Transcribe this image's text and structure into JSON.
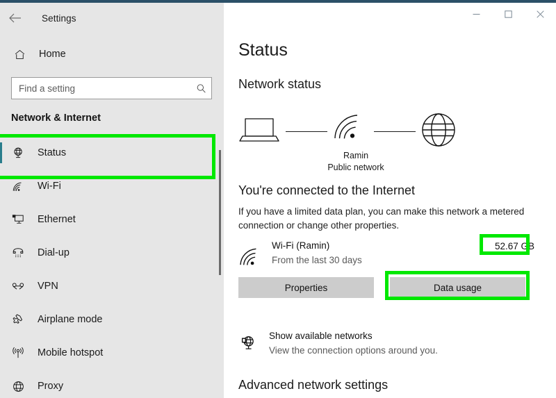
{
  "window": {
    "app_title": "Settings",
    "back_icon": "back-arrow-icon",
    "controls": {
      "minimize": "—",
      "maximize": "□",
      "close": "✕"
    },
    "top_border_color": "#2b5068"
  },
  "sidebar": {
    "home_label": "Home",
    "home_icon": "home-icon",
    "search": {
      "placeholder": "Find a setting",
      "value": "",
      "icon": "search-icon"
    },
    "section_title": "Network & Internet",
    "selected_index": 0,
    "accent_color": "#2a7d8c",
    "items": [
      {
        "label": "Status",
        "icon": "status-globe-icon",
        "selected": true
      },
      {
        "label": "Wi-Fi",
        "icon": "wifi-icon",
        "selected": false
      },
      {
        "label": "Ethernet",
        "icon": "ethernet-icon",
        "selected": false
      },
      {
        "label": "Dial-up",
        "icon": "dialup-phone-icon",
        "selected": false
      },
      {
        "label": "VPN",
        "icon": "vpn-icon",
        "selected": false
      },
      {
        "label": "Airplane mode",
        "icon": "airplane-icon",
        "selected": false
      },
      {
        "label": "Mobile hotspot",
        "icon": "mobile-hotspot-icon",
        "selected": false
      },
      {
        "label": "Proxy",
        "icon": "proxy-globe-icon",
        "selected": false
      }
    ]
  },
  "main": {
    "page_title": "Status",
    "network_status_heading": "Network status",
    "diagram": {
      "device_icon": "laptop-icon",
      "link_icon": "wifi-signal-icon",
      "internet_icon": "globe-icon",
      "network_name": "Ramin",
      "network_type": "Public network"
    },
    "connection": {
      "title": "You're connected to the Internet",
      "description": "If you have a limited data plan, you can make this network a metered connection or change other properties."
    },
    "adapter": {
      "icon": "wifi-icon",
      "name": "Wi-Fi (Ramin)",
      "subtitle": "From the last 30 days",
      "data_usage": "52.67 GB"
    },
    "buttons": {
      "properties": "Properties",
      "data_usage": "Data usage"
    },
    "available_networks": {
      "icon": "globe-display-icon",
      "title": "Show available networks",
      "subtitle": "View the connection options around you."
    },
    "advanced_heading": "Advanced network settings"
  },
  "annotations": {
    "color": "#00e800",
    "boxes": [
      {
        "name": "status-sidebar-item"
      },
      {
        "name": "data-usage-value"
      },
      {
        "name": "data-usage-button"
      }
    ]
  }
}
